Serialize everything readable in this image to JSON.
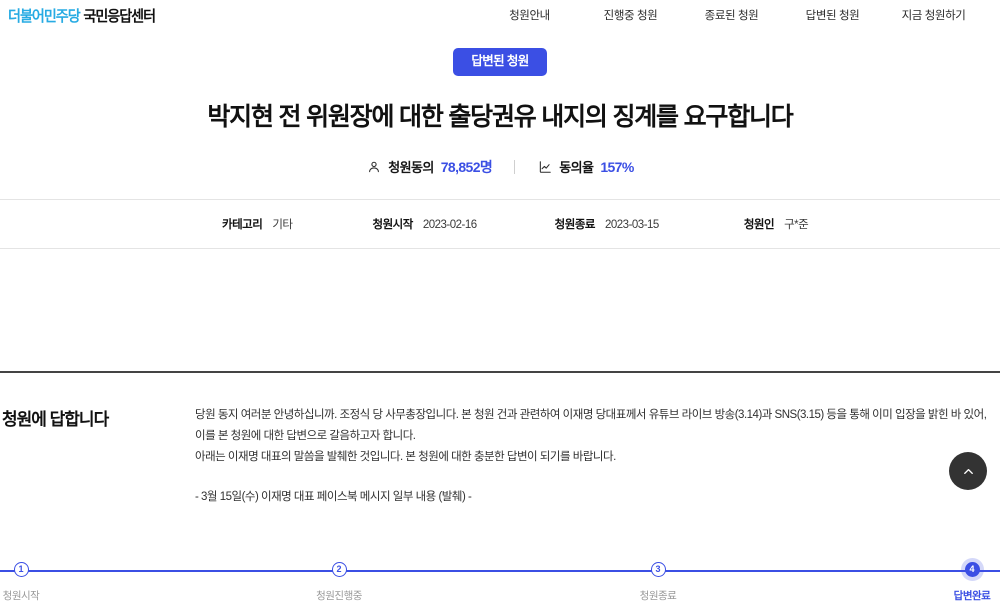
{
  "header": {
    "logo": {
      "party": "더불어민주당",
      "center": "국민응답센터"
    },
    "nav": [
      {
        "label": "청원안내",
        "name": "nav-item-guide"
      },
      {
        "label": "진행중 청원",
        "name": "nav-item-ongoing"
      },
      {
        "label": "종료된 청원",
        "name": "nav-item-closed"
      },
      {
        "label": "답변된 청원",
        "name": "nav-item-answered"
      },
      {
        "label": "지금 청원하기",
        "name": "nav-item-create"
      }
    ]
  },
  "hero": {
    "status_badge": "답변된 청원",
    "title": "박지현 전 위원장에 대한 출당권유 내지의 징계를 요구합니다",
    "stats": {
      "agree_label": "청원동의",
      "agree_value": "78,852명",
      "rate_label": "동의율",
      "rate_value": "157%"
    }
  },
  "meta": {
    "category_key": "카테고리",
    "category_value": "기타",
    "start_key": "청원시작",
    "start_value": "2023-02-16",
    "end_key": "청원종료",
    "end_value": "2023-03-15",
    "petitioner_key": "청원인",
    "petitioner_value": "구*준"
  },
  "progress": {
    "steps": [
      {
        "number": "1",
        "label": "청원시작",
        "active": false
      },
      {
        "number": "2",
        "label": "청원진행중",
        "active": false
      },
      {
        "number": "3",
        "label": "청원종료",
        "active": false
      },
      {
        "number": "4",
        "label": "답변완료",
        "active": true
      }
    ]
  },
  "answer": {
    "heading": "청원에 답합니다",
    "paragraph_1": "당원 동지 여러분 안녕하십니까. 조정식 당 사무총장입니다. 본 청원 건과 관련하여 이재명 당대표께서 유튜브 라이브 방송(3.14)과 SNS(3.15) 등을 통해 이미 입장을 밝힌 바 있어, 이를 본 청원에 대한 답변으로 갈음하고자 합니다.",
    "paragraph_2": "아래는 이재명 대표의 말씀을 발췌한 것입니다. 본 청원에 대한 충분한 답변이 되기를 바랍니다.",
    "paragraph_3": "- 3월 15일(수) 이재명 대표 페이스북 메시지 일부 내용 (발췌) -"
  },
  "scroll_top": {
    "label": "맨 위로"
  },
  "colors": {
    "brand_blue": "#3B4FE4",
    "logo_blue": "#27ABE3",
    "scroll_button": "#333333"
  }
}
